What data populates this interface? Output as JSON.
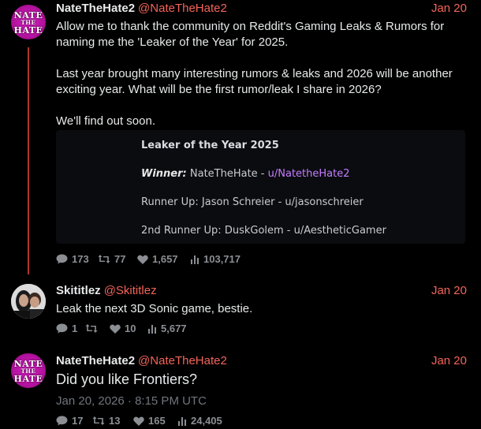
{
  "posts": [
    {
      "author": "NateTheHate2",
      "handle": "@NateTheHate2",
      "date": "Jan 20",
      "avatar_text": [
        "NATE",
        "THE",
        "HATE"
      ],
      "paragraphs": [
        "Allow me to thank the community on Reddit's Gaming Leaks & Rumors for naming me the 'Leaker of the Year' for 2025.",
        "Last year brought many interesting rumors & leaks and 2026 will be another exciting year. What will be the first rumor/leak I share in 2026?",
        "We'll find out soon."
      ],
      "quote": {
        "title": "Leaker of the Year 2025",
        "winner_label": "Winner:",
        "winner_name": "NateTheHate -",
        "winner_user": "u/NatetheHate2",
        "runner_up": "Runner Up: Jason Schreier - u/jasonschreier",
        "second_runner_up": "2nd Runner Up: DuskGolem - u/AestheticGamer"
      },
      "stats": {
        "replies": "173",
        "reposts": "77",
        "likes": "1,657",
        "views": "103,717"
      }
    },
    {
      "author": "Skititlez",
      "handle": "@Skititlez",
      "date": "Jan 20",
      "text": "Leak the next 3D Sonic game, bestie.",
      "stats": {
        "replies": "1",
        "reposts": "",
        "likes": "10",
        "views": "5,677"
      }
    },
    {
      "author": "NateTheHate2",
      "handle": "@NateTheHate2",
      "date": "Jan 20",
      "avatar_text": [
        "NATE",
        "THE",
        "HATE"
      ],
      "text": "Did you like Frontiers?",
      "timestamp": "Jan 20, 2026 · 8:15 PM UTC",
      "stats": {
        "replies": "17",
        "reposts": "13",
        "likes": "165",
        "views": "24,405"
      }
    }
  ],
  "colors": {
    "accent": "#f4645a",
    "thread_line": "#b3332b",
    "link": "#c77dff",
    "muted": "#8b8f94"
  },
  "icons": [
    "reply-icon",
    "repost-icon",
    "like-icon",
    "views-icon"
  ]
}
